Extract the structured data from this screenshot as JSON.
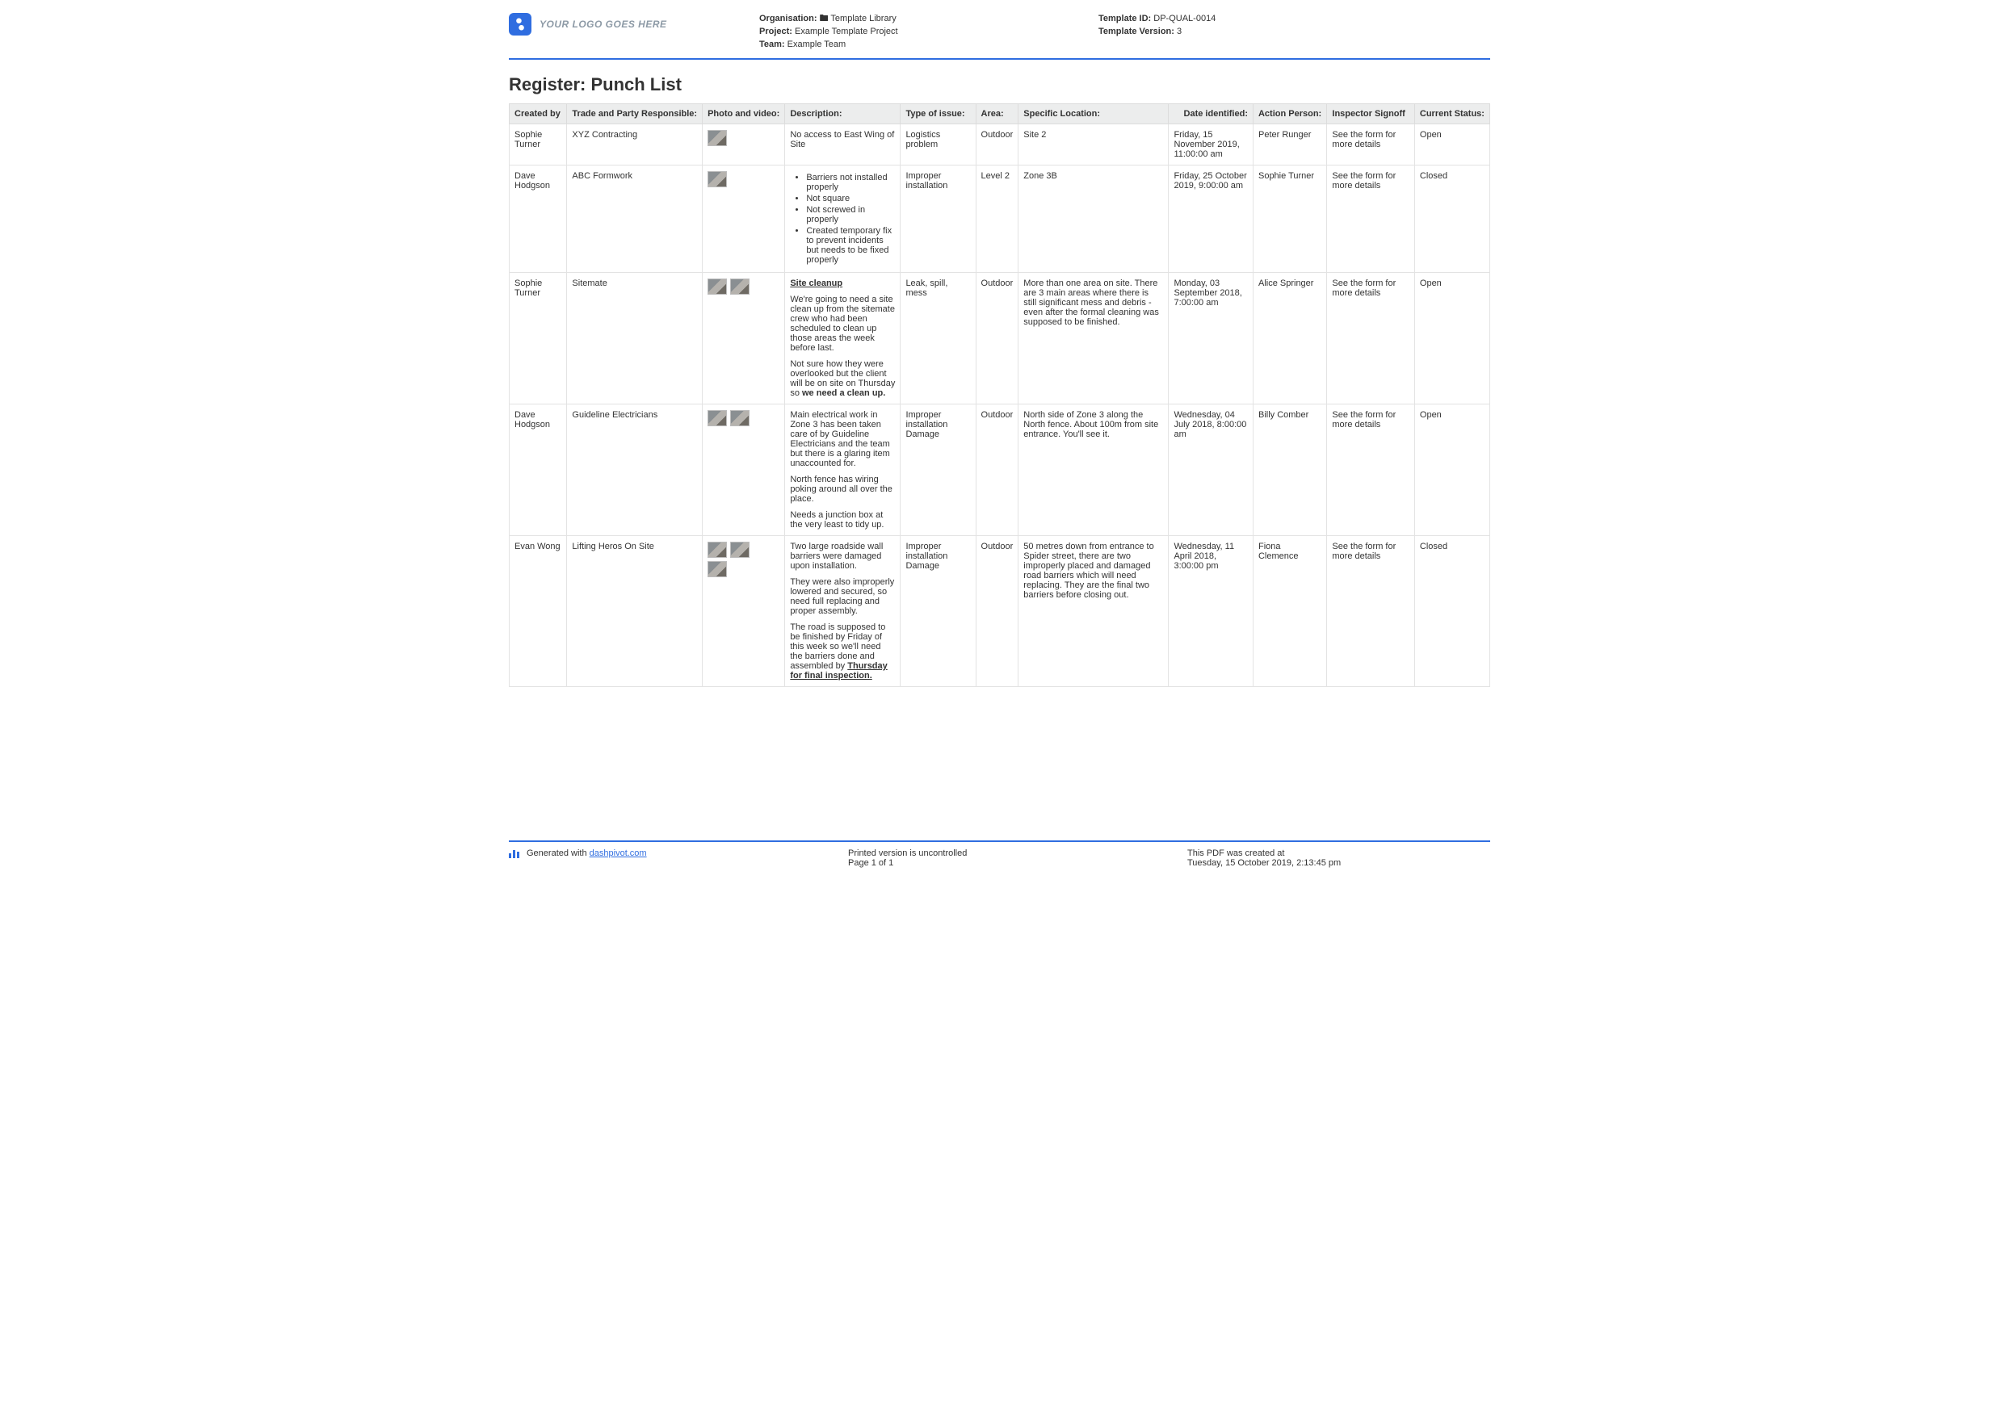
{
  "header": {
    "logo_text": "YOUR LOGO GOES HERE",
    "org_label": "Organisation:",
    "org_value": "🖿 Template Library",
    "project_label": "Project:",
    "project_value": "Example Template Project",
    "team_label": "Team:",
    "team_value": "Example Team",
    "tid_label": "Template ID:",
    "tid_value": "DP-QUAL-0014",
    "tver_label": "Template Version:",
    "tver_value": "3"
  },
  "title": "Register: Punch List",
  "columns": {
    "c0": "Created by",
    "c1": "Trade and Party Responsible:",
    "c2": "Photo and video:",
    "c3": "Description:",
    "c4": "Type of issue:",
    "c5": "Area:",
    "c6": "Specific Location:",
    "c7": "Date identified:",
    "c8": "Action Person:",
    "c9": "Inspector Signoff",
    "c10": "Current Status:"
  },
  "rows": {
    "r0": {
      "created_by": "Sophie Turner",
      "trade": "XYZ Contracting",
      "thumbnail_count": 1,
      "desc_plain": "No access to East Wing of Site",
      "type": "Logistics problem",
      "area": "Outdoor",
      "location": "Site 2",
      "date": "Friday, 15 November 2019, 11:00:00 am",
      "action": "Peter Runger",
      "signoff": "See the form for more details",
      "status": "Open"
    },
    "r1": {
      "created_by": "Dave Hodgson",
      "trade": "ABC Formwork",
      "thumbnail_count": 1,
      "desc_list": {
        "i0": "Barriers not installed properly",
        "i1": "Not square",
        "i2": "Not screwed in properly",
        "i3": "Created temporary fix to prevent incidents but needs to be fixed properly"
      },
      "type": "Improper installation",
      "area": "Level 2",
      "location": "Zone 3B",
      "date": "Friday, 25 October 2019, 9:00:00 am",
      "action": "Sophie Turner",
      "signoff": "See the form for more details",
      "status": "Closed"
    },
    "r2": {
      "created_by": "Sophie Turner",
      "trade": "Sitemate",
      "thumbnail_count": 2,
      "desc_h": "Site cleanup",
      "desc_p1": "We're going to need a site clean up from the sitemate crew who had been scheduled to clean up those areas the week before last.",
      "desc_p2a": "Not sure how they were overlooked but the client will be on site on Thursday so ",
      "desc_p2b": "we need a clean up.",
      "type": "Leak, spill, mess",
      "area": "Outdoor",
      "location": "More than one area on site. There are 3 main areas where there is still significant mess and debris - even after the formal cleaning was supposed to be finished.",
      "date": "Monday, 03 September 2018, 7:00:00 am",
      "action": "Alice Springer",
      "signoff": "See the form for more details",
      "status": "Open"
    },
    "r3": {
      "created_by": "Dave Hodgson",
      "trade": "Guideline Electricians",
      "thumbnail_count": 2,
      "desc_p1": "Main electrical work in Zone 3 has been taken care of by Guideline Electricians and the team but there is a glaring item unaccounted for.",
      "desc_p2": "North fence has wiring poking around all over the place.",
      "desc_p3": "Needs a junction box at the very least to tidy up.",
      "type": "Improper installation Damage",
      "area": "Outdoor",
      "location": "North side of Zone 3 along the North fence. About 100m from site entrance. You'll see it.",
      "date": "Wednesday, 04 July 2018, 8:00:00 am",
      "action": "Billy Comber",
      "signoff": "See the form for more details",
      "status": "Open"
    },
    "r4": {
      "created_by": "Evan Wong",
      "trade": "Lifting Heros On Site",
      "thumbnail_count": 3,
      "desc_p1": "Two large roadside wall barriers were damaged upon installation.",
      "desc_p2": "They were also improperly lowered and secured, so need full replacing and proper assembly.",
      "desc_p3a": "The road is supposed to be finished by Friday of this week so we'll need the barriers done and assembled by ",
      "desc_p3b": "Thursday for final inspection.",
      "type": "Improper installation Damage",
      "area": "Outdoor",
      "location": "50 metres down from entrance to Spider street, there are two improperly placed and damaged road barriers which will need replacing. They are the final two barriers before closing out.",
      "date": "Wednesday, 11 April 2018, 3:00:00 pm",
      "action": "Fiona Clemence",
      "signoff": "See the form for more details",
      "status": "Closed"
    }
  },
  "footer": {
    "gen_prefix": "Generated with ",
    "gen_link": "dashpivot.com",
    "center1": "Printed version is uncontrolled",
    "center2": "Page 1 of 1",
    "right1": "This PDF was created at",
    "right2": "Tuesday, 15 October 2019, 2:13:45 pm"
  }
}
